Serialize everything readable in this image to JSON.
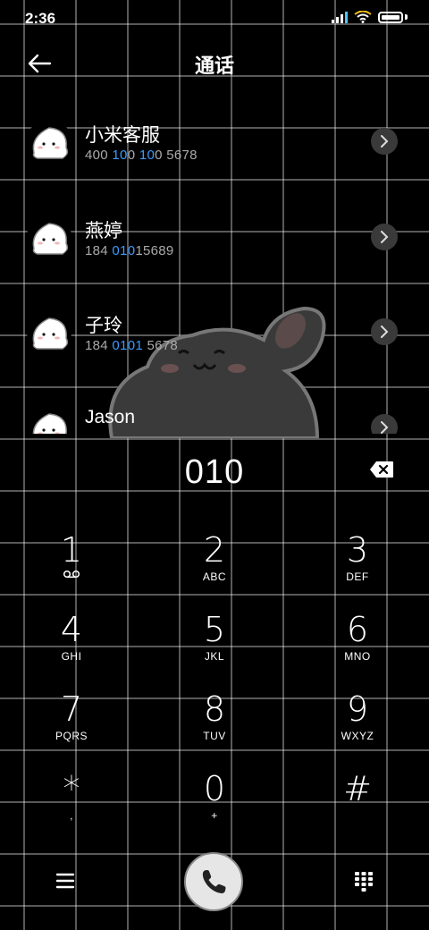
{
  "status_bar": {
    "time": "2:36"
  },
  "header": {
    "title": "通话",
    "back_icon": "arrow-left-icon"
  },
  "contacts": [
    {
      "name": "小米客服",
      "number_parts": [
        "400 ",
        "10",
        "0 ",
        "10",
        "0 5678"
      ],
      "chevron": "chevron-right-icon"
    },
    {
      "name": "燕婷",
      "number_parts": [
        "184 ",
        "010",
        "15689"
      ],
      "chevron": "chevron-right-icon"
    },
    {
      "name": "子玲",
      "number_parts": [
        "184 ",
        "0101",
        " 5678"
      ],
      "chevron": "chevron-right-icon"
    },
    {
      "name": "Jason",
      "chevron": "chevron-right-icon"
    }
  ],
  "dialer": {
    "input_value": "010",
    "keys": [
      {
        "digit": "1",
        "sub": "voicemail-icon"
      },
      {
        "digit": "2",
        "sub": "ABC"
      },
      {
        "digit": "3",
        "sub": "DEF"
      },
      {
        "digit": "4",
        "sub": "GHI"
      },
      {
        "digit": "5",
        "sub": "JKL"
      },
      {
        "digit": "6",
        "sub": "MNO"
      },
      {
        "digit": "7",
        "sub": "PQRS"
      },
      {
        "digit": "8",
        "sub": "TUV"
      },
      {
        "digit": "9",
        "sub": "WXYZ"
      },
      {
        "digit": "*",
        "sub": ","
      },
      {
        "digit": "0",
        "sub": "+"
      },
      {
        "digit": "#",
        "sub": ""
      }
    ]
  },
  "bottom_bar": {
    "menu_icon": "menu-icon",
    "call_icon": "phone-icon",
    "keypad_icon": "keypad-icon"
  },
  "colors": {
    "highlight": "#3a9bff",
    "background": "#000000",
    "call_button": "#e6e6e6"
  }
}
